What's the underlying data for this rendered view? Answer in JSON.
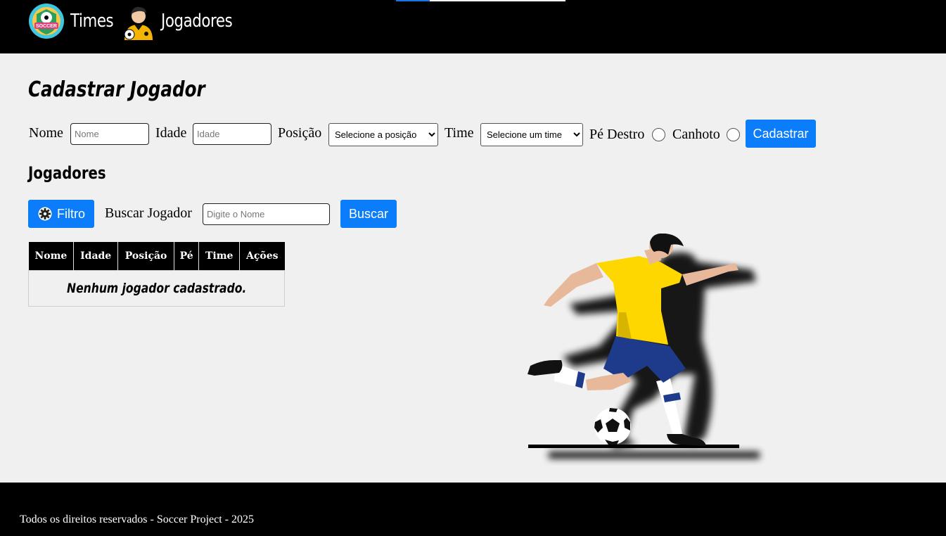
{
  "nav": {
    "times_label": "Times",
    "jogadores_label": "Jogadores",
    "logo_text": "SOCCER"
  },
  "page": {
    "title": "Cadastrar Jogador"
  },
  "form": {
    "nome_label": "Nome",
    "nome_placeholder": "Nome",
    "idade_label": "Idade",
    "idade_placeholder": "Idade",
    "posicao_label": "Posição",
    "posicao_selected": "Selecione a posição",
    "time_label": "Time",
    "time_selected": "Selecione um time",
    "pe_destro_label": "Pé Destro",
    "canhoto_label": "Canhoto",
    "submit_label": "Cadastrar"
  },
  "list": {
    "title": "Jogadores",
    "filter_label": "Filtro",
    "filter_icon": "gear-icon",
    "search_label": "Buscar Jogador",
    "search_placeholder": "Digite o Nome",
    "search_button": "Buscar",
    "columns": [
      "Nome",
      "Idade",
      "Posição",
      "Pé",
      "Time",
      "Ações"
    ],
    "empty_message": "Nenhum jogador cadastrado."
  },
  "footer": {
    "text": "Todos os direitos reservados - Soccer Project - 2025"
  },
  "colors": {
    "primary": "#0b7dfb",
    "header_bg": "#000000",
    "page_bg": "#f0f0f0",
    "jersey": "#ffd700",
    "shorts": "#1e3a8a"
  }
}
